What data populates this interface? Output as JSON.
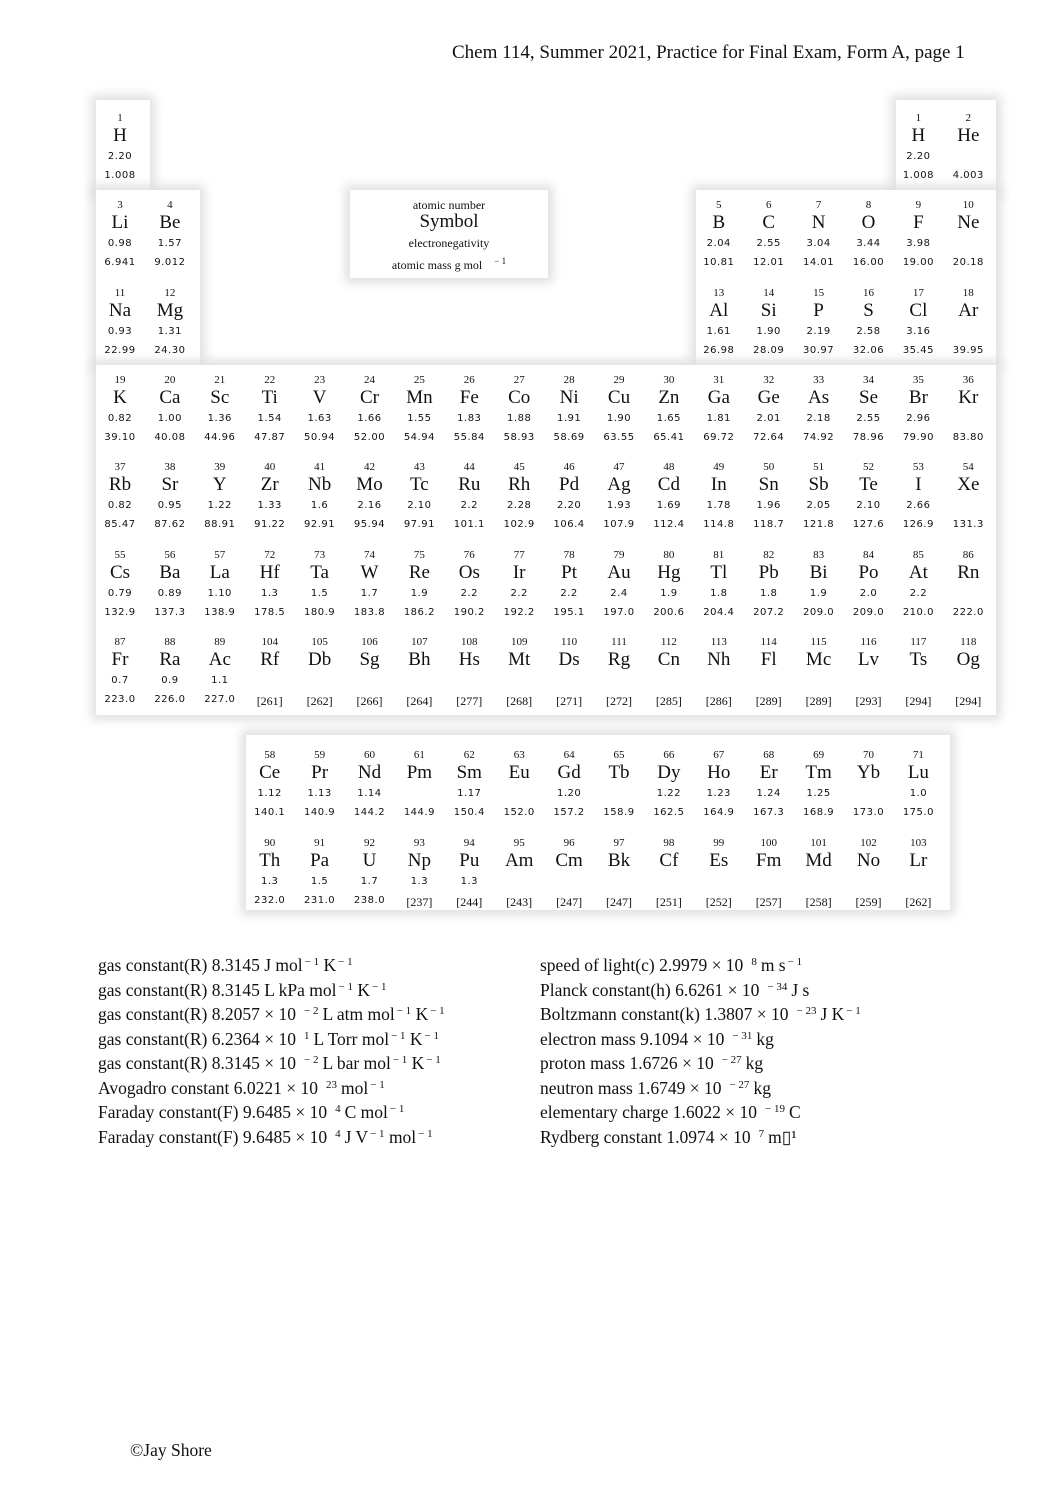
{
  "header": {
    "title": "Chem 114, Summer 2021, Practice for Final Exam, Form A, page 1"
  },
  "legend": {
    "atomic_number": "atomic number",
    "symbol": "Symbol",
    "electronegativity": "electronegativity",
    "atomic_mass": "atomic mass g mol",
    "atomic_mass_exp": "− 1"
  },
  "elements": [
    {
      "n": "1",
      "s": "H",
      "en": "2.20",
      "m": "1.008",
      "row": 1,
      "col": 1
    },
    {
      "n": "1",
      "s": "H",
      "en": "2.20",
      "m": "1.008",
      "row": 1,
      "col": 17
    },
    {
      "n": "2",
      "s": "He",
      "en": "",
      "m": "4.003",
      "row": 1,
      "col": 18
    },
    {
      "n": "3",
      "s": "Li",
      "en": "0.98",
      "m": "6.941",
      "row": 2,
      "col": 1
    },
    {
      "n": "4",
      "s": "Be",
      "en": "1.57",
      "m": "9.012",
      "row": 2,
      "col": 2
    },
    {
      "n": "5",
      "s": "B",
      "en": "2.04",
      "m": "10.81",
      "row": 2,
      "col": 13
    },
    {
      "n": "6",
      "s": "C",
      "en": "2.55",
      "m": "12.01",
      "row": 2,
      "col": 14
    },
    {
      "n": "7",
      "s": "N",
      "en": "3.04",
      "m": "14.01",
      "row": 2,
      "col": 15
    },
    {
      "n": "8",
      "s": "O",
      "en": "3.44",
      "m": "16.00",
      "row": 2,
      "col": 16
    },
    {
      "n": "9",
      "s": "F",
      "en": "3.98",
      "m": "19.00",
      "row": 2,
      "col": 17
    },
    {
      "n": "10",
      "s": "Ne",
      "en": "",
      "m": "20.18",
      "row": 2,
      "col": 18
    },
    {
      "n": "11",
      "s": "Na",
      "en": "0.93",
      "m": "22.99",
      "row": 3,
      "col": 1
    },
    {
      "n": "12",
      "s": "Mg",
      "en": "1.31",
      "m": "24.30",
      "row": 3,
      "col": 2
    },
    {
      "n": "13",
      "s": "Al",
      "en": "1.61",
      "m": "26.98",
      "row": 3,
      "col": 13
    },
    {
      "n": "14",
      "s": "Si",
      "en": "1.90",
      "m": "28.09",
      "row": 3,
      "col": 14
    },
    {
      "n": "15",
      "s": "P",
      "en": "2.19",
      "m": "30.97",
      "row": 3,
      "col": 15
    },
    {
      "n": "16",
      "s": "S",
      "en": "2.58",
      "m": "32.06",
      "row": 3,
      "col": 16
    },
    {
      "n": "17",
      "s": "Cl",
      "en": "3.16",
      "m": "35.45",
      "row": 3,
      "col": 17
    },
    {
      "n": "18",
      "s": "Ar",
      "en": "",
      "m": "39.95",
      "row": 3,
      "col": 18
    },
    {
      "n": "19",
      "s": "K",
      "en": "0.82",
      "m": "39.10",
      "row": 4,
      "col": 1
    },
    {
      "n": "20",
      "s": "Ca",
      "en": "1.00",
      "m": "40.08",
      "row": 4,
      "col": 2
    },
    {
      "n": "21",
      "s": "Sc",
      "en": "1.36",
      "m": "44.96",
      "row": 4,
      "col": 3
    },
    {
      "n": "22",
      "s": "Ti",
      "en": "1.54",
      "m": "47.87",
      "row": 4,
      "col": 4
    },
    {
      "n": "23",
      "s": "V",
      "en": "1.63",
      "m": "50.94",
      "row": 4,
      "col": 5
    },
    {
      "n": "24",
      "s": "Cr",
      "en": "1.66",
      "m": "52.00",
      "row": 4,
      "col": 6
    },
    {
      "n": "25",
      "s": "Mn",
      "en": "1.55",
      "m": "54.94",
      "row": 4,
      "col": 7
    },
    {
      "n": "26",
      "s": "Fe",
      "en": "1.83",
      "m": "55.84",
      "row": 4,
      "col": 8
    },
    {
      "n": "27",
      "s": "Co",
      "en": "1.88",
      "m": "58.93",
      "row": 4,
      "col": 9
    },
    {
      "n": "28",
      "s": "Ni",
      "en": "1.91",
      "m": "58.69",
      "row": 4,
      "col": 10
    },
    {
      "n": "29",
      "s": "Cu",
      "en": "1.90",
      "m": "63.55",
      "row": 4,
      "col": 11
    },
    {
      "n": "30",
      "s": "Zn",
      "en": "1.65",
      "m": "65.41",
      "row": 4,
      "col": 12
    },
    {
      "n": "31",
      "s": "Ga",
      "en": "1.81",
      "m": "69.72",
      "row": 4,
      "col": 13
    },
    {
      "n": "32",
      "s": "Ge",
      "en": "2.01",
      "m": "72.64",
      "row": 4,
      "col": 14
    },
    {
      "n": "33",
      "s": "As",
      "en": "2.18",
      "m": "74.92",
      "row": 4,
      "col": 15
    },
    {
      "n": "34",
      "s": "Se",
      "en": "2.55",
      "m": "78.96",
      "row": 4,
      "col": 16
    },
    {
      "n": "35",
      "s": "Br",
      "en": "2.96",
      "m": "79.90",
      "row": 4,
      "col": 17
    },
    {
      "n": "36",
      "s": "Kr",
      "en": "",
      "m": "83.80",
      "row": 4,
      "col": 18
    },
    {
      "n": "37",
      "s": "Rb",
      "en": "0.82",
      "m": "85.47",
      "row": 5,
      "col": 1
    },
    {
      "n": "38",
      "s": "Sr",
      "en": "0.95",
      "m": "87.62",
      "row": 5,
      "col": 2
    },
    {
      "n": "39",
      "s": "Y",
      "en": "1.22",
      "m": "88.91",
      "row": 5,
      "col": 3
    },
    {
      "n": "40",
      "s": "Zr",
      "en": "1.33",
      "m": "91.22",
      "row": 5,
      "col": 4
    },
    {
      "n": "41",
      "s": "Nb",
      "en": "1.6",
      "m": "92.91",
      "row": 5,
      "col": 5
    },
    {
      "n": "42",
      "s": "Mo",
      "en": "2.16",
      "m": "95.94",
      "row": 5,
      "col": 6
    },
    {
      "n": "43",
      "s": "Tc",
      "en": "2.10",
      "m": "97.91",
      "row": 5,
      "col": 7
    },
    {
      "n": "44",
      "s": "Ru",
      "en": "2.2",
      "m": "101.1",
      "row": 5,
      "col": 8
    },
    {
      "n": "45",
      "s": "Rh",
      "en": "2.28",
      "m": "102.9",
      "row": 5,
      "col": 9
    },
    {
      "n": "46",
      "s": "Pd",
      "en": "2.20",
      "m": "106.4",
      "row": 5,
      "col": 10
    },
    {
      "n": "47",
      "s": "Ag",
      "en": "1.93",
      "m": "107.9",
      "row": 5,
      "col": 11
    },
    {
      "n": "48",
      "s": "Cd",
      "en": "1.69",
      "m": "112.4",
      "row": 5,
      "col": 12
    },
    {
      "n": "49",
      "s": "In",
      "en": "1.78",
      "m": "114.8",
      "row": 5,
      "col": 13
    },
    {
      "n": "50",
      "s": "Sn",
      "en": "1.96",
      "m": "118.7",
      "row": 5,
      "col": 14
    },
    {
      "n": "51",
      "s": "Sb",
      "en": "2.05",
      "m": "121.8",
      "row": 5,
      "col": 15
    },
    {
      "n": "52",
      "s": "Te",
      "en": "2.10",
      "m": "127.6",
      "row": 5,
      "col": 16
    },
    {
      "n": "53",
      "s": "I",
      "en": "2.66",
      "m": "126.9",
      "row": 5,
      "col": 17
    },
    {
      "n": "54",
      "s": "Xe",
      "en": "",
      "m": "131.3",
      "row": 5,
      "col": 18
    },
    {
      "n": "55",
      "s": "Cs",
      "en": "0.79",
      "m": "132.9",
      "row": 6,
      "col": 1
    },
    {
      "n": "56",
      "s": "Ba",
      "en": "0.89",
      "m": "137.3",
      "row": 6,
      "col": 2
    },
    {
      "n": "57",
      "s": "La",
      "en": "1.10",
      "m": "138.9",
      "row": 6,
      "col": 3
    },
    {
      "n": "72",
      "s": "Hf",
      "en": "1.3",
      "m": "178.5",
      "row": 6,
      "col": 4
    },
    {
      "n": "73",
      "s": "Ta",
      "en": "1.5",
      "m": "180.9",
      "row": 6,
      "col": 5
    },
    {
      "n": "74",
      "s": "W",
      "en": "1.7",
      "m": "183.8",
      "row": 6,
      "col": 6
    },
    {
      "n": "75",
      "s": "Re",
      "en": "1.9",
      "m": "186.2",
      "row": 6,
      "col": 7
    },
    {
      "n": "76",
      "s": "Os",
      "en": "2.2",
      "m": "190.2",
      "row": 6,
      "col": 8
    },
    {
      "n": "77",
      "s": "Ir",
      "en": "2.2",
      "m": "192.2",
      "row": 6,
      "col": 9
    },
    {
      "n": "78",
      "s": "Pt",
      "en": "2.2",
      "m": "195.1",
      "row": 6,
      "col": 10
    },
    {
      "n": "79",
      "s": "Au",
      "en": "2.4",
      "m": "197.0",
      "row": 6,
      "col": 11
    },
    {
      "n": "80",
      "s": "Hg",
      "en": "1.9",
      "m": "200.6",
      "row": 6,
      "col": 12
    },
    {
      "n": "81",
      "s": "Tl",
      "en": "1.8",
      "m": "204.4",
      "row": 6,
      "col": 13
    },
    {
      "n": "82",
      "s": "Pb",
      "en": "1.8",
      "m": "207.2",
      "row": 6,
      "col": 14
    },
    {
      "n": "83",
      "s": "Bi",
      "en": "1.9",
      "m": "209.0",
      "row": 6,
      "col": 15
    },
    {
      "n": "84",
      "s": "Po",
      "en": "2.0",
      "m": "209.0",
      "row": 6,
      "col": 16
    },
    {
      "n": "85",
      "s": "At",
      "en": "2.2",
      "m": "210.0",
      "row": 6,
      "col": 17
    },
    {
      "n": "86",
      "s": "Rn",
      "en": "",
      "m": "222.0",
      "row": 6,
      "col": 18
    },
    {
      "n": "87",
      "s": "Fr",
      "en": "0.7",
      "m": "223.0",
      "row": 7,
      "col": 1
    },
    {
      "n": "88",
      "s": "Ra",
      "en": "0.9",
      "m": "226.0",
      "row": 7,
      "col": 2
    },
    {
      "n": "89",
      "s": "Ac",
      "en": "1.1",
      "m": "227.0",
      "row": 7,
      "col": 3
    },
    {
      "n": "104",
      "s": "Rf",
      "en": "",
      "m": "[261]",
      "row": 7,
      "col": 4
    },
    {
      "n": "105",
      "s": "Db",
      "en": "",
      "m": "[262]",
      "row": 7,
      "col": 5
    },
    {
      "n": "106",
      "s": "Sg",
      "en": "",
      "m": "[266]",
      "row": 7,
      "col": 6
    },
    {
      "n": "107",
      "s": "Bh",
      "en": "",
      "m": "[264]",
      "row": 7,
      "col": 7
    },
    {
      "n": "108",
      "s": "Hs",
      "en": "",
      "m": "[277]",
      "row": 7,
      "col": 8
    },
    {
      "n": "109",
      "s": "Mt",
      "en": "",
      "m": "[268]",
      "row": 7,
      "col": 9
    },
    {
      "n": "110",
      "s": "Ds",
      "en": "",
      "m": "[271]",
      "row": 7,
      "col": 10
    },
    {
      "n": "111",
      "s": "Rg",
      "en": "",
      "m": "[272]",
      "row": 7,
      "col": 11
    },
    {
      "n": "112",
      "s": "Cn",
      "en": "",
      "m": "[285]",
      "row": 7,
      "col": 12
    },
    {
      "n": "113",
      "s": "Nh",
      "en": "",
      "m": "[286]",
      "row": 7,
      "col": 13
    },
    {
      "n": "114",
      "s": "Fl",
      "en": "",
      "m": "[289]",
      "row": 7,
      "col": 14
    },
    {
      "n": "115",
      "s": "Mc",
      "en": "",
      "m": "[289]",
      "row": 7,
      "col": 15
    },
    {
      "n": "116",
      "s": "Lv",
      "en": "",
      "m": "[293]",
      "row": 7,
      "col": 16
    },
    {
      "n": "117",
      "s": "Ts",
      "en": "",
      "m": "[294]",
      "row": 7,
      "col": 17
    },
    {
      "n": "118",
      "s": "Og",
      "en": "",
      "m": "[294]",
      "row": 7,
      "col": 18
    },
    {
      "n": "58",
      "s": "Ce",
      "en": "1.12",
      "m": "140.1",
      "row": 8,
      "col": 4
    },
    {
      "n": "59",
      "s": "Pr",
      "en": "1.13",
      "m": "140.9",
      "row": 8,
      "col": 5
    },
    {
      "n": "60",
      "s": "Nd",
      "en": "1.14",
      "m": "144.2",
      "row": 8,
      "col": 6
    },
    {
      "n": "61",
      "s": "Pm",
      "en": "",
      "m": "144.9",
      "row": 8,
      "col": 7
    },
    {
      "n": "62",
      "s": "Sm",
      "en": "1.17",
      "m": "150.4",
      "row": 8,
      "col": 8
    },
    {
      "n": "63",
      "s": "Eu",
      "en": "",
      "m": "152.0",
      "row": 8,
      "col": 9
    },
    {
      "n": "64",
      "s": "Gd",
      "en": "1.20",
      "m": "157.2",
      "row": 8,
      "col": 10
    },
    {
      "n": "65",
      "s": "Tb",
      "en": "",
      "m": "158.9",
      "row": 8,
      "col": 11
    },
    {
      "n": "66",
      "s": "Dy",
      "en": "1.22",
      "m": "162.5",
      "row": 8,
      "col": 12
    },
    {
      "n": "67",
      "s": "Ho",
      "en": "1.23",
      "m": "164.9",
      "row": 8,
      "col": 13
    },
    {
      "n": "68",
      "s": "Er",
      "en": "1.24",
      "m": "167.3",
      "row": 8,
      "col": 14
    },
    {
      "n": "69",
      "s": "Tm",
      "en": "1.25",
      "m": "168.9",
      "row": 8,
      "col": 15
    },
    {
      "n": "70",
      "s": "Yb",
      "en": "",
      "m": "173.0",
      "row": 8,
      "col": 16
    },
    {
      "n": "71",
      "s": "Lu",
      "en": "1.0",
      "m": "175.0",
      "row": 8,
      "col": 17
    },
    {
      "n": "90",
      "s": "Th",
      "en": "1.3",
      "m": "232.0",
      "row": 9,
      "col": 4
    },
    {
      "n": "91",
      "s": "Pa",
      "en": "1.5",
      "m": "231.0",
      "row": 9,
      "col": 5
    },
    {
      "n": "92",
      "s": "U",
      "en": "1.7",
      "m": "238.0",
      "row": 9,
      "col": 6
    },
    {
      "n": "93",
      "s": "Np",
      "en": "1.3",
      "m": "[237]",
      "row": 9,
      "col": 7
    },
    {
      "n": "94",
      "s": "Pu",
      "en": "1.3",
      "m": "[244]",
      "row": 9,
      "col": 8
    },
    {
      "n": "95",
      "s": "Am",
      "en": "",
      "m": "[243]",
      "row": 9,
      "col": 9
    },
    {
      "n": "96",
      "s": "Cm",
      "en": "",
      "m": "[247]",
      "row": 9,
      "col": 10
    },
    {
      "n": "97",
      "s": "Bk",
      "en": "",
      "m": "[247]",
      "row": 9,
      "col": 11
    },
    {
      "n": "98",
      "s": "Cf",
      "en": "",
      "m": "[251]",
      "row": 9,
      "col": 12
    },
    {
      "n": "99",
      "s": "Es",
      "en": "",
      "m": "[252]",
      "row": 9,
      "col": 13
    },
    {
      "n": "100",
      "s": "Fm",
      "en": "",
      "m": "[257]",
      "row": 9,
      "col": 14
    },
    {
      "n": "101",
      "s": "Md",
      "en": "",
      "m": "[258]",
      "row": 9,
      "col": 15
    },
    {
      "n": "102",
      "s": "No",
      "en": "",
      "m": "[259]",
      "row": 9,
      "col": 16
    },
    {
      "n": "103",
      "s": "Lr",
      "en": "",
      "m": "[262]",
      "row": 9,
      "col": 17
    }
  ],
  "constants_left": [
    {
      "name": "gas constant(R)",
      "mantissa": "8.3145",
      "exp": "",
      "units": [
        [
          "J mol",
          ""
        ],
        [
          "",
          "− 1"
        ],
        [
          " K",
          ""
        ],
        [
          "",
          "− 1"
        ]
      ]
    },
    {
      "name": "gas constant(R)",
      "mantissa": "8.3145",
      "exp": "",
      "units": [
        [
          "L kPa mol",
          ""
        ],
        [
          "",
          "− 1"
        ],
        [
          " K",
          ""
        ],
        [
          "",
          "− 1"
        ]
      ]
    },
    {
      "name": "gas constant(R)",
      "mantissa": "8.2057 × 10",
      "exp": "− 2",
      "units": [
        [
          "L atm mol",
          ""
        ],
        [
          "",
          "− 1"
        ],
        [
          " K",
          ""
        ],
        [
          "",
          "− 1"
        ]
      ]
    },
    {
      "name": "gas constant(R)",
      "mantissa": "6.2364 × 10",
      "exp": "1",
      "units": [
        [
          "L Torr mol",
          ""
        ],
        [
          "",
          "− 1"
        ],
        [
          " K",
          ""
        ],
        [
          "",
          "− 1"
        ]
      ]
    },
    {
      "name": "gas constant(R)",
      "mantissa": "8.3145 × 10",
      "exp": "− 2",
      "units": [
        [
          "L bar mol",
          ""
        ],
        [
          "",
          "− 1"
        ],
        [
          " K",
          ""
        ],
        [
          "",
          "− 1"
        ]
      ]
    },
    {
      "name": "Avogadro constant",
      "mantissa": "6.0221 × 10",
      "exp": "23",
      "units": [
        [
          "mol",
          ""
        ],
        [
          "",
          "− 1"
        ]
      ]
    },
    {
      "name": "Faraday constant(F)",
      "mantissa": "9.6485 × 10",
      "exp": "4",
      "units": [
        [
          "C mol",
          ""
        ],
        [
          "",
          "− 1"
        ]
      ]
    },
    {
      "name": "Faraday constant(F)",
      "mantissa": "9.6485 × 10",
      "exp": "4",
      "units": [
        [
          "J V",
          ""
        ],
        [
          "",
          "− 1"
        ],
        [
          " mol",
          ""
        ],
        [
          "",
          "− 1"
        ]
      ]
    }
  ],
  "constants_right": [
    {
      "name": "speed of light(c)",
      "mantissa": "2.9979 × 10",
      "exp": "8",
      "units": [
        [
          "m s",
          ""
        ],
        [
          "",
          "− 1"
        ]
      ]
    },
    {
      "name": "Planck constant(h)",
      "mantissa": "6.6261 × 10",
      "exp": "− 34",
      "units": [
        [
          "J s",
          ""
        ]
      ]
    },
    {
      "name": "Boltzmann constant(k)",
      "mantissa": "1.3807 × 10",
      "exp": "− 23",
      "units": [
        [
          "J K",
          ""
        ],
        [
          "",
          "− 1"
        ]
      ]
    },
    {
      "name": "electron mass",
      "mantissa": "9.1094 × 10",
      "exp": "− 31",
      "units": [
        [
          "kg",
          ""
        ]
      ]
    },
    {
      "name": "proton mass",
      "mantissa": "1.6726 × 10",
      "exp": "− 27",
      "units": [
        [
          "kg",
          ""
        ]
      ]
    },
    {
      "name": "neutron mass",
      "mantissa": "1.6749 × 10",
      "exp": "− 27",
      "units": [
        [
          "kg",
          ""
        ]
      ]
    },
    {
      "name": "elementary charge",
      "mantissa": "1.6022 × 10",
      "exp": "− 19",
      "units": [
        [
          "C",
          ""
        ]
      ]
    },
    {
      "name": "Rydberg constant",
      "mantissa": "1.0974 × 10",
      "exp": "7",
      "units": [
        [
          "m▯¹",
          ""
        ]
      ]
    }
  ],
  "footer": {
    "copyright": "©Jay Shore"
  }
}
